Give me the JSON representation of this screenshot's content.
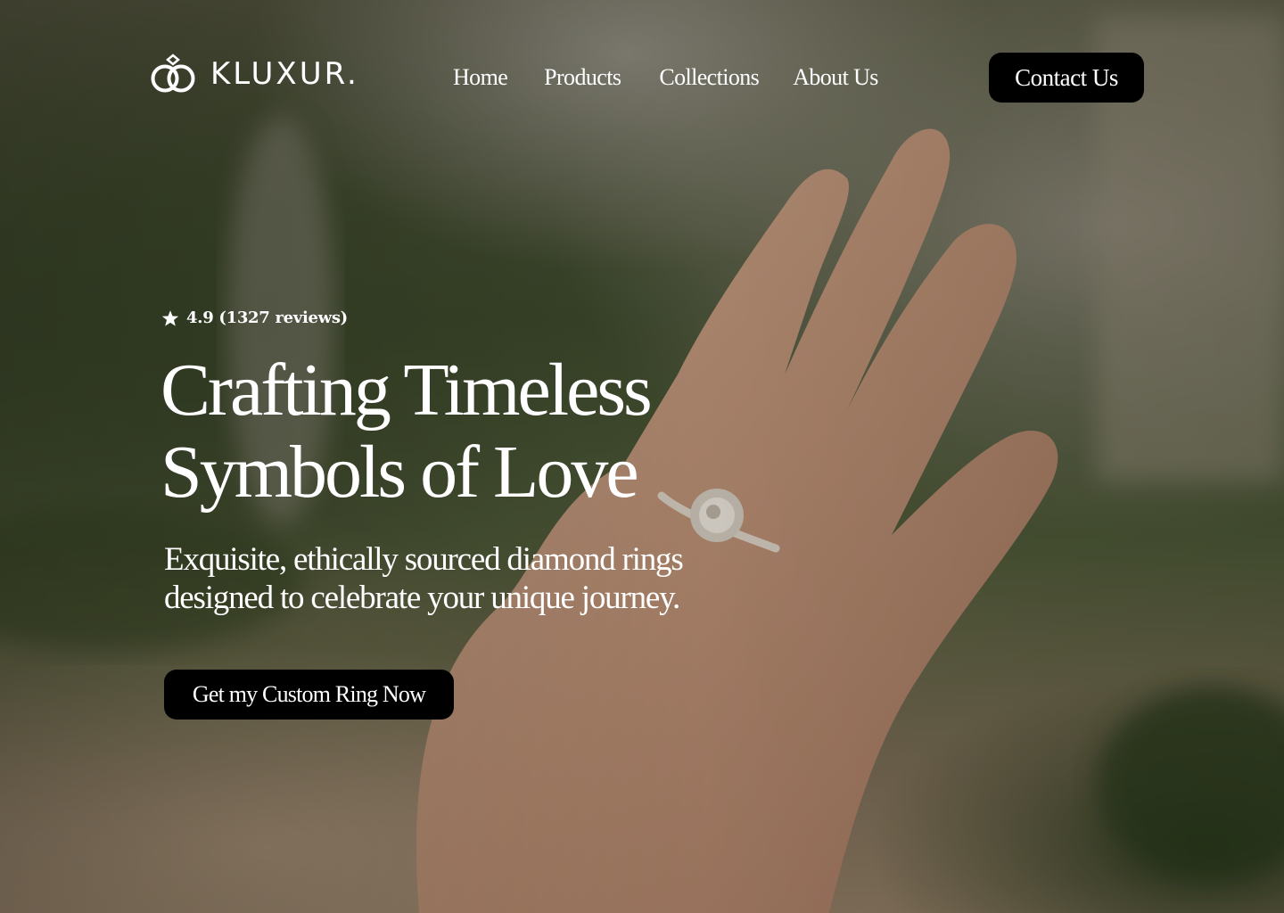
{
  "brand": {
    "name": "KLUXUR.",
    "logo_icon": "interlocked-rings-icon"
  },
  "nav": {
    "items": [
      "Home",
      "Products",
      "Collections",
      "About Us"
    ]
  },
  "header": {
    "contact_label": "Contact Us"
  },
  "hero": {
    "rating_icon": "star-icon",
    "rating_text": "4.9 (1327 reviews)",
    "headline_line1": "Crafting Timeless",
    "headline_line2": "Symbols of Love",
    "subhead_line1": "Exquisite, ethically sourced diamond rings",
    "subhead_line2": "designed to celebrate your unique journey.",
    "cta_label": "Get my Custom Ring Now"
  },
  "colors": {
    "button_bg": "#000000",
    "text": "#ffffff"
  }
}
